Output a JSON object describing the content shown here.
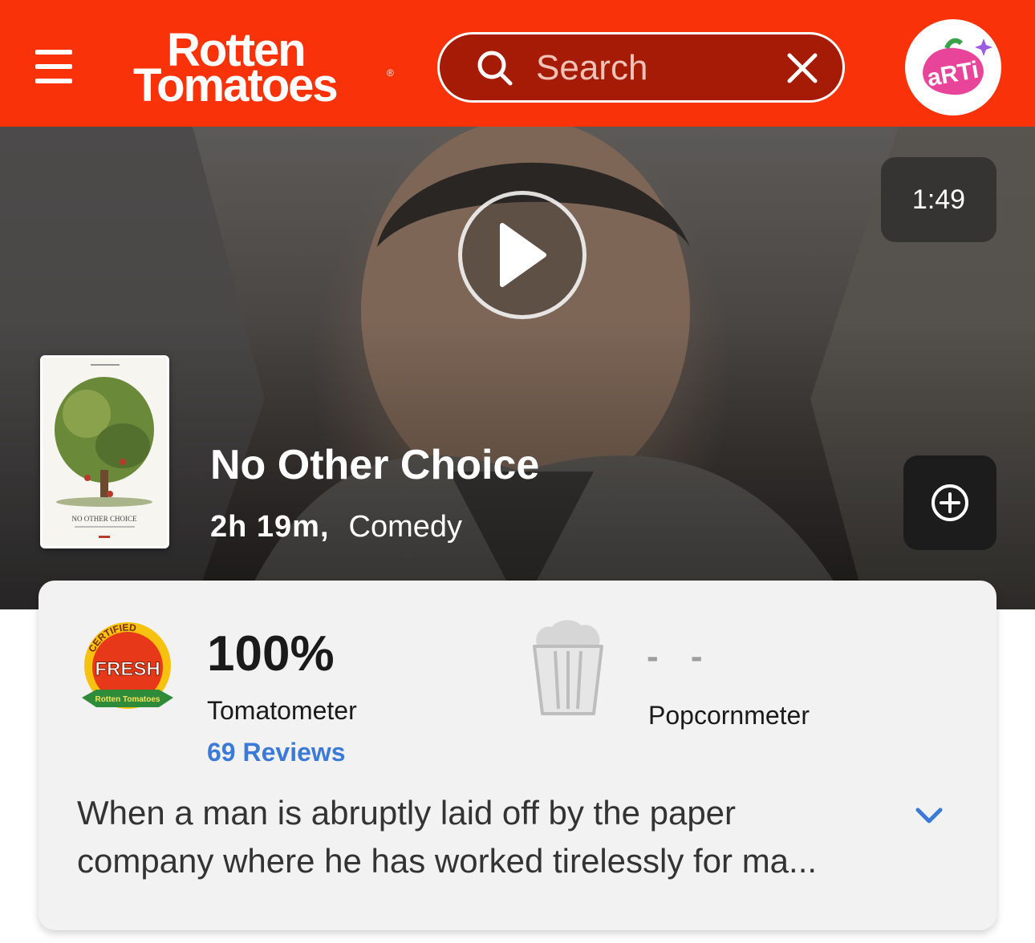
{
  "header": {
    "logo_line1": "Rotten",
    "logo_line2": "Tomatoes",
    "logo_reg": "®",
    "search_placeholder": "Search",
    "avatar_text": "aRTi",
    "menu_icon": "hamburger-icon",
    "search_icon": "search-icon",
    "clear_icon": "close-icon"
  },
  "hero": {
    "video_duration": "1:49",
    "movie_title": "No Other Choice",
    "runtime": "2h 19m,",
    "genre": "Comedy",
    "poster_caption": "NO OTHER CHOICE"
  },
  "scores": {
    "badge_top": "CERTIFIED",
    "badge_main": "FRESH",
    "badge_brand": "Rotten Tomatoes",
    "tomatometer_value": "100%",
    "tomatometer_label": "Tomatometer",
    "reviews_count": "69 Reviews",
    "popcornmeter_value": "- -",
    "popcornmeter_label": "Popcornmeter"
  },
  "synopsis": {
    "text": "When a man is abruptly laid off by the paper company where he has worked tirelessly for ma..."
  },
  "colors": {
    "brand_red": "#fa320a",
    "link_blue": "#3b7ad6"
  }
}
